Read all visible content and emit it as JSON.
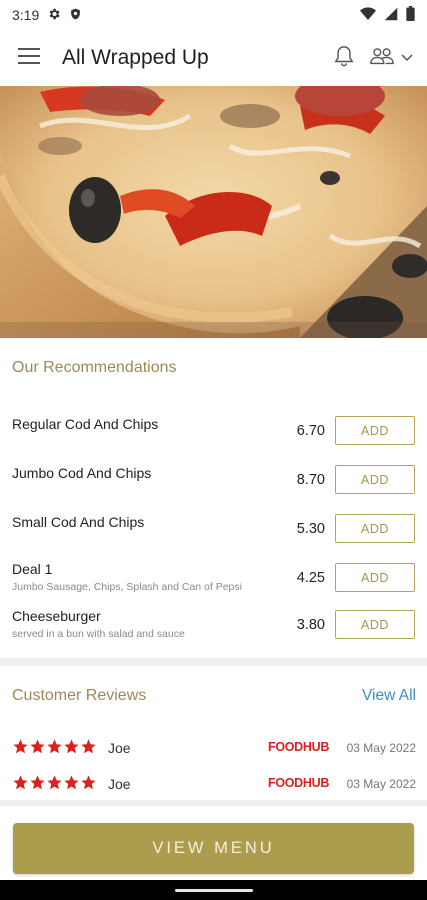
{
  "status_bar": {
    "time": "3:19"
  },
  "app_bar": {
    "title": "All Wrapped Up"
  },
  "recommendations": {
    "title": "Our Recommendations",
    "add_label": "ADD",
    "items": [
      {
        "name": "Regular Cod And Chips",
        "description": "",
        "price": "6.70"
      },
      {
        "name": "Jumbo Cod And Chips",
        "description": "",
        "price": "8.70"
      },
      {
        "name": "Small Cod And Chips",
        "description": "",
        "price": "5.30"
      },
      {
        "name": "Deal 1",
        "description": "Jumbo Sausage, Chips, Splash and Can of Pepsi",
        "price": "4.25"
      },
      {
        "name": "Cheeseburger",
        "description": "served in a bun with salad and sauce",
        "price": "3.80"
      }
    ]
  },
  "reviews": {
    "title": "Customer Reviews",
    "view_all": "View All",
    "items": [
      {
        "reviewer": "Joe",
        "rating": 5,
        "source": "FOODHUB",
        "date": "03 May 2022"
      },
      {
        "reviewer": "Joe",
        "rating": 5,
        "source": "FOODHUB",
        "date": "03 May 2022"
      }
    ]
  },
  "footer": {
    "view_menu_label": "VIEW MENU"
  },
  "colors": {
    "accent": "#ab9d4d",
    "star": "#d9221c",
    "link": "#3a8fbf"
  }
}
